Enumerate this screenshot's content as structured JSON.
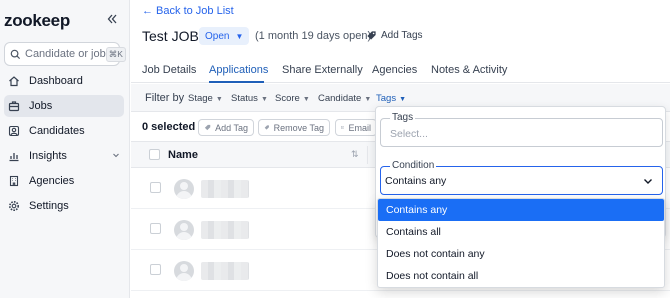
{
  "sidebar": {
    "logo": "zookeep",
    "collapse_icon": "chevrons-left-icon",
    "search": {
      "placeholder": "Candidate or job",
      "shortcut": "⌘K"
    },
    "items": [
      {
        "label": "Dashboard",
        "icon": "home-icon",
        "active": false
      },
      {
        "label": "Jobs",
        "icon": "briefcase-icon",
        "active": true
      },
      {
        "label": "Candidates",
        "icon": "user-icon",
        "active": false
      },
      {
        "label": "Insights",
        "icon": "chart-icon",
        "active": false,
        "expandable": true
      },
      {
        "label": "Agencies",
        "icon": "building-icon",
        "active": false
      },
      {
        "label": "Settings",
        "icon": "gear-icon",
        "active": false
      }
    ]
  },
  "header": {
    "back_link": "← Back to Job List",
    "job_title": "Test JOB",
    "status": "Open",
    "duration": "(1 month 19 days open)",
    "add_tags": "Add Tags"
  },
  "tabs": [
    "Job Details",
    "Applications",
    "Share Externally",
    "Agencies",
    "Notes & Activity"
  ],
  "active_tab": "Applications",
  "filters": {
    "label": "Filter by",
    "chips": [
      "Stage",
      "Status",
      "Score",
      "Candidate",
      "Tags"
    ]
  },
  "actions": {
    "selected": "0 selected",
    "add_tag": "Add Tag",
    "remove_tag": "Remove Tag",
    "email": "Email"
  },
  "table": {
    "column_name": "Name",
    "row_count": 3
  },
  "tags_filter": {
    "tags_label": "Tags",
    "tags_placeholder": "Select...",
    "condition_label": "Condition",
    "condition_value": "Contains any",
    "options": [
      "Contains any",
      "Contains all",
      "Does not contain any",
      "Does not contain all"
    ],
    "selected_option": "Contains any"
  },
  "colors": {
    "accent": "#2563eb",
    "selected_option": "#1a6ef5"
  }
}
